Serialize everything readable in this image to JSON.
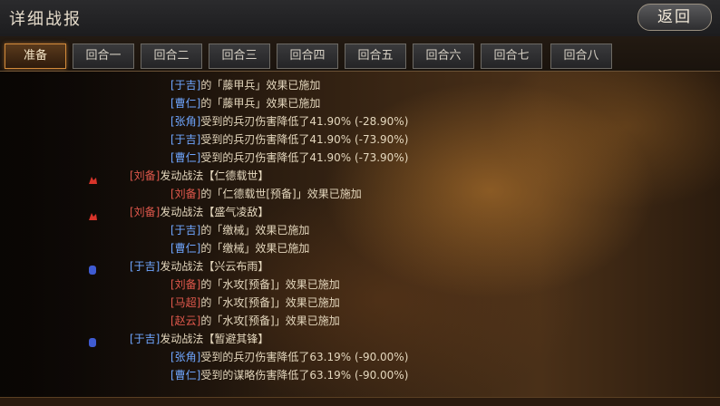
{
  "header": {
    "title": "详细战报",
    "back_label": "返回"
  },
  "tabs": [
    {
      "label": "准备",
      "active": true
    },
    {
      "label": "回合一",
      "active": false
    },
    {
      "label": "回合二",
      "active": false
    },
    {
      "label": "回合三",
      "active": false
    },
    {
      "label": "回合四",
      "active": false
    },
    {
      "label": "回合五",
      "active": false
    },
    {
      "label": "回合六",
      "active": false
    },
    {
      "label": "回合七",
      "active": false
    },
    {
      "label": "回合八",
      "active": false
    }
  ],
  "log": [
    {
      "name": "[于吉]",
      "name_color": "blue",
      "text": "的「藤甲兵」效果已施加"
    },
    {
      "name": "[曹仁]",
      "name_color": "blue",
      "text": "的「藤甲兵」效果已施加"
    },
    {
      "name": "[张角]",
      "name_color": "blue",
      "text": "受到的兵刃伤害降低了41.90% (-28.90%)"
    },
    {
      "name": "[于吉]",
      "name_color": "blue",
      "text": "受到的兵刃伤害降低了41.90% (-73.90%)"
    },
    {
      "name": "[曹仁]",
      "name_color": "blue",
      "text": "受到的兵刃伤害降低了41.90% (-73.90%)"
    },
    {
      "name": "[刘备]",
      "name_color": "red",
      "text": "发动战法【仁德载世】",
      "marker": "red"
    },
    {
      "name": "[刘备]",
      "name_color": "red",
      "text": "的「仁德载世[预备]」效果已施加"
    },
    {
      "name": "[刘备]",
      "name_color": "red",
      "text": "发动战法【盛气凌敌】",
      "marker": "red"
    },
    {
      "name": "[于吉]",
      "name_color": "blue",
      "text": "的「缴械」效果已施加"
    },
    {
      "name": "[曹仁]",
      "name_color": "blue",
      "text": "的「缴械」效果已施加"
    },
    {
      "name": "[于吉]",
      "name_color": "blue",
      "text": "发动战法【兴云布雨】",
      "marker": "blue"
    },
    {
      "name": "[刘备]",
      "name_color": "red",
      "text": "的「水攻[预备]」效果已施加"
    },
    {
      "name": "[马超]",
      "name_color": "red",
      "text": "的「水攻[预备]」效果已施加"
    },
    {
      "name": "[赵云]",
      "name_color": "red",
      "text": "的「水攻[预备]」效果已施加"
    },
    {
      "name": "[于吉]",
      "name_color": "blue",
      "text": "发动战法【暂避其锋】",
      "marker": "blue"
    },
    {
      "name": "[张角]",
      "name_color": "blue",
      "text": "受到的兵刃伤害降低了63.19% (-90.00%)"
    },
    {
      "name": "[曹仁]",
      "name_color": "blue",
      "text": "受到的谋略伤害降低了63.19% (-90.00%)"
    }
  ],
  "colors": {
    "ally_name": "#e0584c",
    "enemy_name": "#6fa6ff",
    "active_tab_border": "#d28a3a"
  }
}
